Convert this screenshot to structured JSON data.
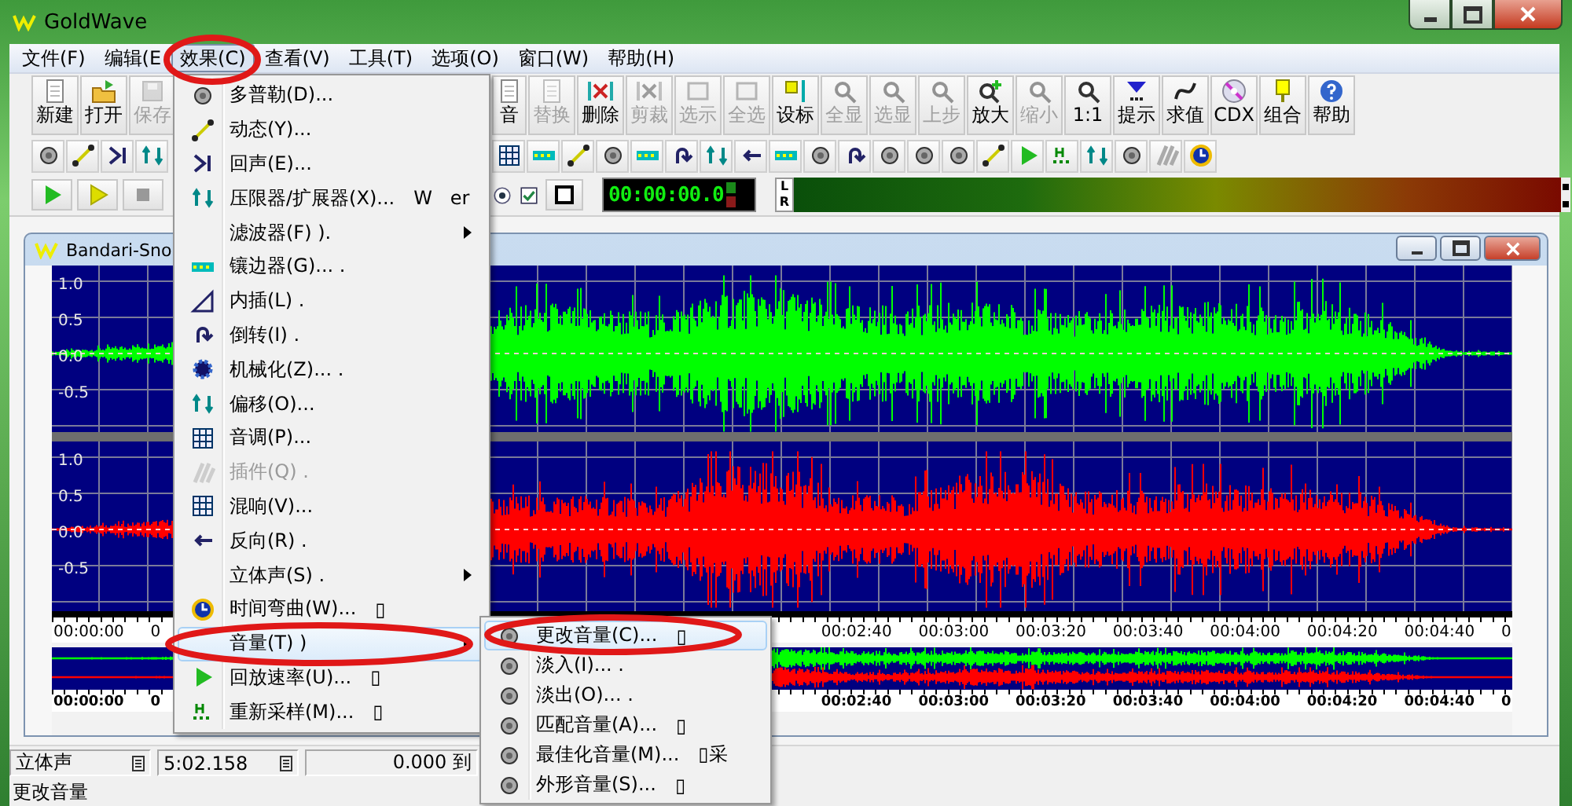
{
  "window": {
    "title": "GoldWave"
  },
  "menu_bar": [
    {
      "label": "文件(F)",
      "selected": false
    },
    {
      "label": "编辑(E",
      "selected": false
    },
    {
      "label": "效果(C)",
      "selected": true
    },
    {
      "label": "查看(V)",
      "selected": false
    },
    {
      "label": "工具(T)",
      "selected": false
    },
    {
      "label": "选项(O)",
      "selected": false
    },
    {
      "label": "窗口(W)",
      "selected": false
    },
    {
      "label": "帮助(H)",
      "selected": false
    }
  ],
  "toolbar": {
    "left": [
      {
        "label": "新建",
        "disabled": false
      },
      {
        "label": "打开",
        "disabled": false
      },
      {
        "label": "保存",
        "disabled": true
      }
    ],
    "right": [
      {
        "label": "音",
        "disabled": false
      },
      {
        "label": "替换",
        "disabled": true
      },
      {
        "label": "删除",
        "disabled": false
      },
      {
        "label": "剪裁",
        "disabled": true
      },
      {
        "label": "选示",
        "disabled": true
      },
      {
        "label": "全选",
        "disabled": true
      },
      {
        "label": "设标",
        "disabled": false
      },
      {
        "label": "全显",
        "disabled": true
      },
      {
        "label": "选显",
        "disabled": true
      },
      {
        "label": "上步",
        "disabled": true
      },
      {
        "label": "放大",
        "disabled": false
      },
      {
        "label": "缩小",
        "disabled": true
      },
      {
        "label": "1:1",
        "disabled": false
      },
      {
        "label": "提示",
        "disabled": false
      },
      {
        "label": "求值",
        "disabled": false
      },
      {
        "label": "CDX",
        "disabled": false
      },
      {
        "label": "组合",
        "disabled": false
      },
      {
        "label": "帮助",
        "disabled": false
      }
    ]
  },
  "transport": {
    "time": "00:00:00.0",
    "meter_labels": [
      "L",
      "R"
    ]
  },
  "child_window": {
    "title": "Bandari-Sno",
    "channels": [
      {
        "axis_labels": [
          "1.0",
          "0.5",
          "0.0",
          "-0.5"
        ]
      },
      {
        "axis_labels": [
          "1.0",
          "0.5",
          "0.0",
          "-0.5"
        ]
      }
    ],
    "ruler": {
      "start_labels": [
        "00:00:00",
        "0"
      ],
      "end_labels": [
        "00:02:40",
        "00:03:00",
        "00:03:20",
        "00:03:40",
        "00:04:00",
        "00:04:20",
        "00:04:40",
        "0"
      ]
    },
    "overview_ruler": {
      "start_labels": [
        "00:00:00",
        "0"
      ],
      "end_labels": [
        "00:02:40",
        "00:03:00",
        "00:03:20",
        "00:03:40",
        "00:04:00",
        "00:04:20",
        "00:04:40",
        "0"
      ]
    }
  },
  "effects_menu": [
    {
      "label": "多普勒(D)...",
      "disabled": false,
      "selected": false,
      "submenu": false
    },
    {
      "label": "动态(Y)...",
      "disabled": false,
      "selected": false,
      "submenu": false
    },
    {
      "label": "回声(E)...",
      "disabled": false,
      "selected": false,
      "submenu": false
    },
    {
      "label": "压限器/扩展器(X)...",
      "shortcut": "W   er",
      "disabled": false,
      "selected": false,
      "submenu": false
    },
    {
      "label": "滤波器(F) ).",
      "disabled": false,
      "selected": false,
      "submenu": true
    },
    {
      "label": "镶边器(G)... .",
      "disabled": false,
      "selected": false,
      "submenu": false
    },
    {
      "label": "内插(L) .",
      "disabled": false,
      "selected": false,
      "submenu": false
    },
    {
      "label": "倒转(I) .",
      "disabled": false,
      "selected": false,
      "submenu": false
    },
    {
      "label": "机械化(Z)... .",
      "disabled": false,
      "selected": false,
      "submenu": false
    },
    {
      "label": "偏移(O)...",
      "disabled": false,
      "selected": false,
      "submenu": false
    },
    {
      "label": "音调(P)...",
      "disabled": false,
      "selected": false,
      "submenu": false
    },
    {
      "label": "插件(Q) .",
      "disabled": true,
      "selected": false,
      "submenu": false
    },
    {
      "label": "混响(V)...",
      "disabled": false,
      "selected": false,
      "submenu": false
    },
    {
      "label": "反向(R) .",
      "disabled": false,
      "selected": false,
      "submenu": false
    },
    {
      "label": "立体声(S) .",
      "disabled": false,
      "selected": false,
      "submenu": true
    },
    {
      "label": "时间弯曲(W)...",
      "shortcut": "▯",
      "disabled": false,
      "selected": false,
      "submenu": false
    },
    {
      "label": "音量(T) )",
      "disabled": false,
      "selected": true,
      "submenu": true
    },
    {
      "label": "回放速率(U)...",
      "shortcut": "▯",
      "disabled": false,
      "selected": false,
      "submenu": false
    },
    {
      "label": "重新采样(M)...",
      "shortcut": "▯",
      "disabled": false,
      "selected": false,
      "submenu": false
    }
  ],
  "volume_submenu": [
    {
      "label": "更改音量(C)...",
      "shortcut": "▯",
      "selected": true
    },
    {
      "label": "淡入(I)... .",
      "selected": false
    },
    {
      "label": "淡出(O)... .",
      "selected": false
    },
    {
      "label": "匹配音量(A)...",
      "shortcut": "▯",
      "selected": false
    },
    {
      "label": "最佳化音量(M)...",
      "shortcut": "▯采",
      "selected": false
    },
    {
      "label": "外形音量(S)...",
      "shortcut": "▯",
      "selected": false
    }
  ],
  "status_bar": [
    "立体声",
    "5:02.158",
    "0.000 到"
  ],
  "status_text": "更改音量"
}
